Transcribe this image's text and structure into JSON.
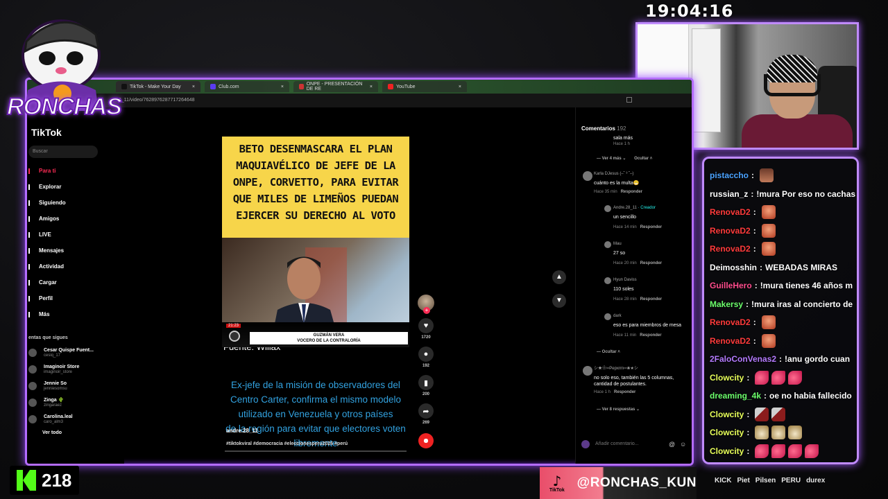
{
  "overlay": {
    "clock": "19:04:16",
    "logo_text": "RONCHAS",
    "kick_viewers": "218",
    "tiktok_handle": "@RONCHAS_KUN",
    "tiktok_mini_label": "TikTok",
    "sponsors": [
      "KICK",
      "Piet",
      "Pilsen",
      "PERU",
      "durex"
    ]
  },
  "browser": {
    "tabs": [
      {
        "label": "TikTok - Make Your Day",
        "active": true
      },
      {
        "label": "Club.com",
        "active": false
      },
      {
        "label": "ONPE - PRESENTACIÓN DE RE",
        "active": false
      },
      {
        "label": "YouTube",
        "active": false
      }
    ],
    "address": "28_11/video/7628976287717264648"
  },
  "tiktok": {
    "logo": "TikTok",
    "search_placeholder": "Buscar",
    "nav": [
      {
        "label": "Para ti",
        "active": true
      },
      {
        "label": "Explorar"
      },
      {
        "label": "Siguiendo"
      },
      {
        "label": "Amigos"
      },
      {
        "label": "LIVE"
      },
      {
        "label": "Mensajes"
      },
      {
        "label": "Actividad"
      },
      {
        "label": "Cargar"
      },
      {
        "label": "Perfil"
      },
      {
        "label": "Más"
      }
    ],
    "following_title": "entas que sigues",
    "following": [
      {
        "name": "Cesar Quispe Fuent...",
        "user": "cesiq_17"
      },
      {
        "name": "Imaginoir Store",
        "user": "imaginoir_store"
      },
      {
        "name": "Jennie So",
        "user": "jenniesomsu"
      },
      {
        "name": "Zinga 🌵",
        "user": "zingaraez"
      },
      {
        "name": "Carolina.leal",
        "user": "caro_alm3"
      }
    ],
    "see_all": "Ver todo",
    "video": {
      "headline": [
        "BETO DESENMASCARA EL PLAN",
        "MAQUIAVÉLICO DE JEFE DE LA",
        "ONPE, CORVETTO,  PARA EVITAR",
        "QUE MILES DE LIMEÑOS PUEDAN",
        "EJERCER SU DERECHO AL VOTO"
      ],
      "source": "Fuente: Willax",
      "time_tag": "21:23",
      "lower_third_name": "GUZMÁN VERA",
      "lower_third_role": "VOCERO DE LA CONTRALORÍA",
      "body": [
        "Ex-jefe  de la misión de observadores  del",
        "Centro Carter, confirma el mismo modelo",
        "utilizado en Venezuela y otros países",
        "de la región para evitar que electores voten",
        "libremente"
      ],
      "author": "andre.28_11",
      "tags": "#tiktokviral #democracia #eleccionesperu2026 #perú",
      "progress": 0.0
    },
    "actions": {
      "likes": "1720",
      "comments": "192",
      "saves": "200",
      "shares": "269"
    },
    "comments_panel": {
      "title": "Comentarios",
      "count": "192",
      "items": [
        {
          "name": "",
          "text": "sala más",
          "time": "Hace 1 h",
          "reply": ""
        },
        {
          "more": "Ver 4 más",
          "hide": "Ocultar"
        },
        {
          "name": "Karla DJesus (–˘ ³ ˘–)",
          "text": "cuánto es la multa😁",
          "time": "Hace 35 min",
          "reply": "Responder"
        },
        {
          "name": "Andre.28_11",
          "creator": "· Creador",
          "text": "un sencillo",
          "time": "Hace 14 min",
          "reply": "Responder"
        },
        {
          "name": "Mau",
          "text": "27 so",
          "time": "Hace 20 min",
          "reply": "Responder"
        },
        {
          "name": "Hyun Daviss",
          "text": "110 soles",
          "time": "Hace 28 min",
          "reply": "Responder"
        },
        {
          "name": "dark",
          "text": "eso es para miembros de mesa",
          "time": "Hace 11 min",
          "reply": "Responder"
        },
        {
          "hide": "Ocultar"
        },
        {
          "name": "シ★❀═Pepxrrn═❀★シ",
          "text": "no solo eso, también las 5 columnas, cantidad de postulantes.",
          "time": "Hace 1 h",
          "reply": "Responder"
        },
        {
          "more": "Ver 8 respuestas"
        }
      ],
      "input_placeholder": "Añadir comentario..."
    }
  },
  "chat": [
    {
      "user": "pistaccho",
      "color": "#4ba3ff",
      "msg": "",
      "emotes": [
        "em-pic"
      ]
    },
    {
      "user": "russian_z",
      "color": "#ffffff",
      "msg": "!mura Por eso no cachas",
      "emotes": []
    },
    {
      "user": "RenovaD2",
      "color": "#ff3b3b",
      "msg": "",
      "emotes": [
        "em-face"
      ]
    },
    {
      "user": "RenovaD2",
      "color": "#ff3b3b",
      "msg": "",
      "emotes": [
        "em-face"
      ]
    },
    {
      "user": "RenovaD2",
      "color": "#ff3b3b",
      "msg": "",
      "emotes": [
        "em-face"
      ]
    },
    {
      "user": "Deimosshin",
      "color": "#ffffff",
      "msg": "WEBADAS MIRAS",
      "emotes": []
    },
    {
      "user": "GuilleHero",
      "color": "#ff4d8d",
      "msg": "!mura tienes 46 años m",
      "emotes": []
    },
    {
      "user": "Makersy",
      "color": "#6cff6c",
      "msg": "!mura iras al concierto de",
      "emotes": []
    },
    {
      "user": "RenovaD2",
      "color": "#ff3b3b",
      "msg": "",
      "emotes": [
        "em-face"
      ]
    },
    {
      "user": "RenovaD2",
      "color": "#ff3b3b",
      "msg": "",
      "emotes": [
        "em-face"
      ]
    },
    {
      "user": "2FaloConVenas2",
      "color": "#b57bff",
      "msg": "!anu gordo cuan",
      "emotes": []
    },
    {
      "user": "Clowcity",
      "color": "#e8ff5a",
      "msg": "",
      "emotes": [
        "em-leg",
        "em-leg",
        "em-leg"
      ]
    },
    {
      "user": "dreaming_4k",
      "color": "#6cff6c",
      "msg": "oe no habia fallecido",
      "emotes": []
    },
    {
      "user": "Clowcity",
      "color": "#e8ff5a",
      "msg": "",
      "emotes": [
        "em-knife",
        "em-knife"
      ]
    },
    {
      "user": "Clowcity",
      "color": "#e8ff5a",
      "msg": "",
      "emotes": [
        "em-hat",
        "em-hat",
        "em-hat"
      ]
    },
    {
      "user": "Clowcity",
      "color": "#e8ff5a",
      "msg": "",
      "emotes": [
        "em-leg",
        "em-leg",
        "em-leg",
        "em-leg"
      ]
    }
  ]
}
